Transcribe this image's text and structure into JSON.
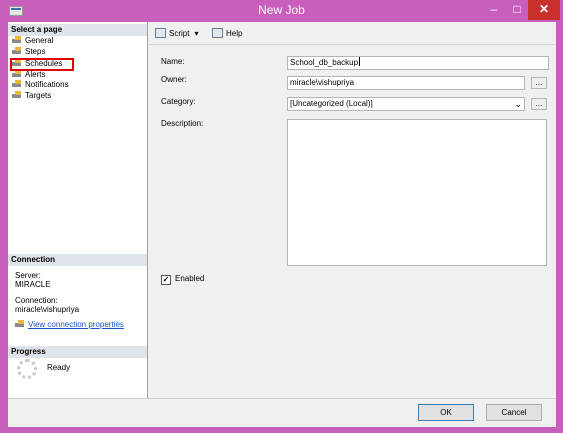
{
  "window": {
    "title": "New Job"
  },
  "left_pane": {
    "select_page_heading": "Select a page",
    "pages": [
      {
        "label": "General"
      },
      {
        "label": "Steps"
      },
      {
        "label": "Schedules"
      },
      {
        "label": "Alerts"
      },
      {
        "label": "Notifications"
      },
      {
        "label": "Targets"
      }
    ],
    "highlighted_page": "Schedules",
    "connection_heading": "Connection",
    "server_label": "Server:",
    "server_value": "MIRACLE",
    "connection_label": "Connection:",
    "connection_value": "miracle\\vishupriya",
    "view_connection_link": "View connection properties",
    "progress_heading": "Progress",
    "progress_status": "Ready"
  },
  "toolbar": {
    "script_label": "Script",
    "help_label": "Help"
  },
  "form": {
    "name_label": "Name:",
    "name_value": "School_db_backup",
    "owner_label": "Owner:",
    "owner_value": "miracle\\vishupriya",
    "category_label": "Category:",
    "category_value": "[Uncategorized (Local)]",
    "description_label": "Description:",
    "description_value": "",
    "enabled_label": "Enabled",
    "enabled_checked": true,
    "browse_label": "..."
  },
  "footer": {
    "ok_label": "OK",
    "cancel_label": "Cancel"
  },
  "colors": {
    "titlebar": "#c85fbd",
    "close_button": "#c9302c",
    "highlight_box": "#e00000",
    "link": "#1a55c9"
  }
}
